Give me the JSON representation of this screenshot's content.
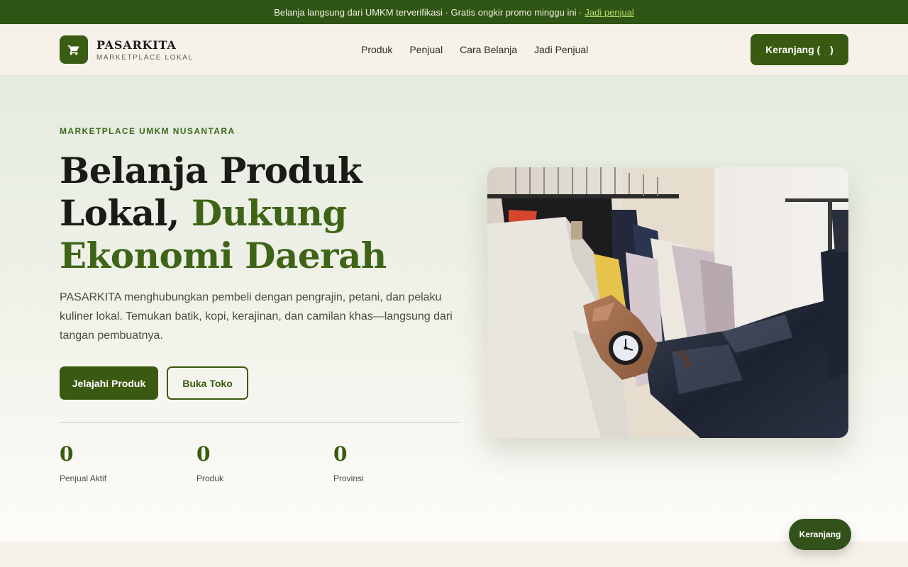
{
  "announcement": {
    "text": "Belanja langsung dari UMKM terverifikasi · Gratis ongkir promo minggu ini ·",
    "link": "Jadi penjual"
  },
  "header": {
    "brand_name": "PASARKITA",
    "brand_tagline": "MARKETPLACE LOKAL",
    "brand_icon": "cart-icon",
    "nav": [
      {
        "label": "Produk"
      },
      {
        "label": "Penjual"
      },
      {
        "label": "Cara Belanja"
      },
      {
        "label": "Jadi Penjual"
      }
    ],
    "cart_label": "Keranjang (",
    "cart_count": "",
    "cart_close": ")"
  },
  "hero": {
    "eyebrow": "MARKETPLACE UMKM NUSANTARA",
    "title_part1": "Belanja Produk Lokal, ",
    "title_highlight": "Dukung Ekonomi Daerah",
    "description": "PASARKITA menghubungkan pembeli dengan pengrajin, petani, dan pelaku kuliner lokal. Temukan batik, kopi, kerajinan, dan camilan khas—langsung dari tangan pembuatnya.",
    "primary_button": "Jelajahi Produk",
    "secondary_button": "Buka Toko",
    "stats": [
      {
        "value": "0",
        "label": "Penjual Aktif"
      },
      {
        "value": "0",
        "label": "Produk"
      },
      {
        "value": "0",
        "label": "Provinsi"
      }
    ]
  },
  "floating_cart": "Keranjang",
  "colors": {
    "brand_green": "#3a5a12",
    "topbar_green": "#2f5514",
    "link_green": "#b7dd6b",
    "cream": "#f5f1e8"
  }
}
